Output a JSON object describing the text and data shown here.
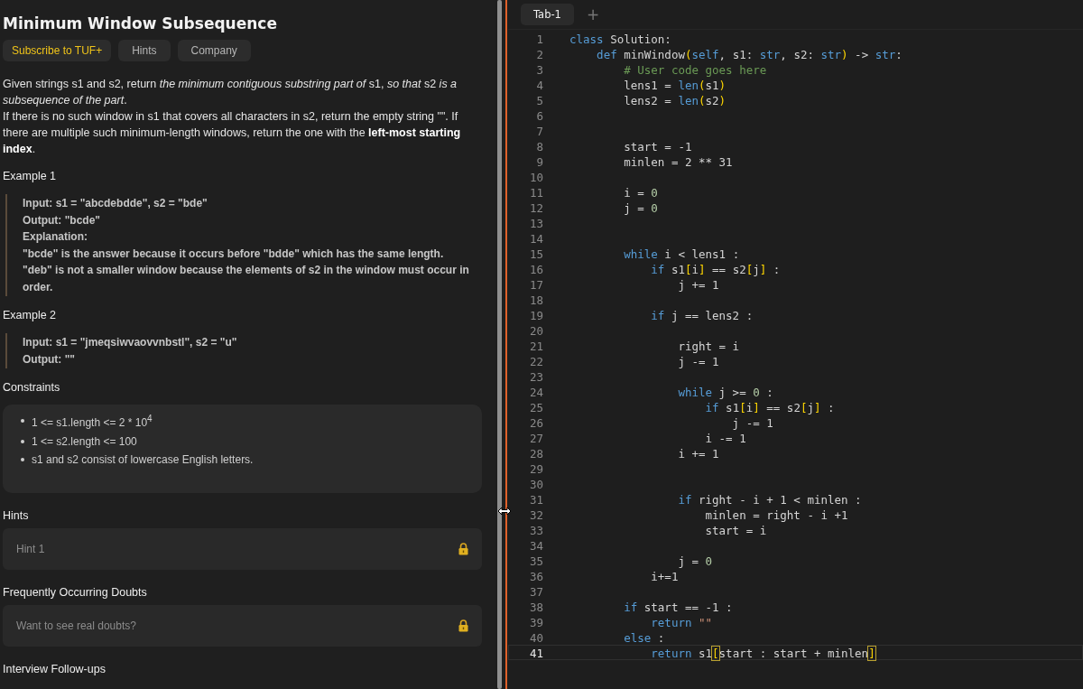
{
  "problem": {
    "title": "Minimum Window Subsequence",
    "buttons": [
      {
        "label": "Subscribe to TUF+",
        "kind": "premium"
      },
      {
        "label": "Hints",
        "kind": "plain"
      },
      {
        "label": "Company",
        "kind": "plain"
      }
    ],
    "description": [
      "Given strings s1 and s2, return *the minimum contiguous substring part of* s1, *so that* s2 *is a subsequence of the part*.",
      "If there is no such window in s1 that covers all characters in s2, return the empty string \"\". If there are multiple such minimum-length windows, return the one with the **left-most starting index**."
    ],
    "examples": [
      {
        "title": "Example 1",
        "lines": [
          "Input: s1 = \"abcdebdde\", s2 = \"bde\"",
          "Output: \"bcde\"",
          "Explanation:",
          "\"bcde\" is the answer because it occurs before \"bdde\" which has the same length.",
          "\"deb\" is not a smaller window because the elements of s2 in the window must occur in order."
        ]
      },
      {
        "title": "Example 2",
        "lines": [
          "Input: s1 = \"jmeqsiwvaovvnbstl\", s2 = \"u\"",
          "Output: \"\""
        ]
      }
    ],
    "constraints_title": "Constraints",
    "constraints": [
      "1 <= s1.length <= 2 * 10$^{4}$",
      "1 <= s2.length <= 100",
      "s1 and s2 consist of lowercase English letters."
    ],
    "sections": [
      {
        "title": "Hints",
        "item": "Hint 1",
        "locked": true
      },
      {
        "title": "Frequently Occurring Doubts",
        "item": "Want to see real doubts?",
        "locked": true
      }
    ],
    "footer_title": "Interview Follow-ups"
  },
  "editor": {
    "tabs": [
      {
        "label": "Tab-1",
        "selected": true
      }
    ],
    "add_tab": "+",
    "lines": [
      {
        "number": "1",
        "active": false,
        "tokens": [
          {
            "kind": "kw",
            "text": "class"
          },
          {
            "kind": "pl",
            "text": " Solution:"
          }
        ]
      },
      {
        "number": "2",
        "active": false,
        "tokens": [
          {
            "kind": "kw",
            "text": "    def"
          },
          {
            "kind": "pl",
            "text": " minWindow"
          },
          {
            "kind": "br",
            "text": "("
          },
          {
            "kind": "kw",
            "text": "self"
          },
          {
            "kind": "pl",
            "text": ", s1: "
          },
          {
            "kind": "kw",
            "text": "str"
          },
          {
            "kind": "pl",
            "text": ", s2: "
          },
          {
            "kind": "kw",
            "text": "str"
          },
          {
            "kind": "br",
            "text": ")"
          },
          {
            "kind": "pl",
            "text": " -> "
          },
          {
            "kind": "kw",
            "text": "str"
          },
          {
            "kind": "pl",
            "text": ":"
          }
        ]
      },
      {
        "number": "3",
        "active": false,
        "tokens": [
          {
            "kind": "cm",
            "text": "        # User code goes here"
          }
        ]
      },
      {
        "number": "4",
        "active": false,
        "tokens": [
          {
            "kind": "pl",
            "text": "        lens1 = "
          },
          {
            "kind": "kw",
            "text": "len"
          },
          {
            "kind": "br",
            "text": "("
          },
          {
            "kind": "pl",
            "text": "s1"
          },
          {
            "kind": "br",
            "text": ")"
          }
        ]
      },
      {
        "number": "5",
        "active": false,
        "tokens": [
          {
            "kind": "pl",
            "text": "        lens2 = "
          },
          {
            "kind": "kw",
            "text": "len"
          },
          {
            "kind": "br",
            "text": "("
          },
          {
            "kind": "pl",
            "text": "s2"
          },
          {
            "kind": "br",
            "text": ")"
          }
        ]
      },
      {
        "number": "6",
        "active": false
      },
      {
        "number": "7",
        "active": false
      },
      {
        "number": "8",
        "active": false,
        "tokens": [
          {
            "kind": "pl",
            "text": "        start = -1"
          }
        ]
      },
      {
        "number": "9",
        "active": false,
        "tokens": [
          {
            "kind": "pl",
            "text": "        minlen = 2 ** 31"
          }
        ]
      },
      {
        "number": "10",
        "active": false
      },
      {
        "number": "11",
        "active": false,
        "tokens": [
          {
            "kind": "pl",
            "text": "        i = "
          },
          {
            "kind": "num",
            "text": "0"
          }
        ]
      },
      {
        "number": "12",
        "active": false,
        "tokens": [
          {
            "kind": "pl",
            "text": "        j = "
          },
          {
            "kind": "num",
            "text": "0"
          }
        ]
      },
      {
        "number": "13",
        "active": false
      },
      {
        "number": "14",
        "active": false
      },
      {
        "number": "15",
        "active": false,
        "tokens": [
          {
            "kind": "kw",
            "text": "        while"
          },
          {
            "kind": "pl",
            "text": " i < lens1 :"
          }
        ]
      },
      {
        "number": "16",
        "active": false,
        "tokens": [
          {
            "kind": "kw",
            "text": "            if"
          },
          {
            "kind": "pl",
            "text": " s1"
          },
          {
            "kind": "br",
            "text": "["
          },
          {
            "kind": "pl",
            "text": "i"
          },
          {
            "kind": "br",
            "text": "]"
          },
          {
            "kind": "pl",
            "text": " == s2"
          },
          {
            "kind": "br",
            "text": "["
          },
          {
            "kind": "pl",
            "text": "j"
          },
          {
            "kind": "br",
            "text": "]"
          },
          {
            "kind": "pl",
            "text": " :"
          }
        ]
      },
      {
        "number": "17",
        "active": false,
        "tokens": [
          {
            "kind": "pl",
            "text": "                j += 1"
          }
        ]
      },
      {
        "number": "18",
        "active": false
      },
      {
        "number": "19",
        "active": false,
        "tokens": [
          {
            "kind": "kw",
            "text": "            if"
          },
          {
            "kind": "pl",
            "text": " j == lens2 :"
          }
        ]
      },
      {
        "number": "20",
        "active": false
      },
      {
        "number": "21",
        "active": false,
        "tokens": [
          {
            "kind": "pl",
            "text": "                right = i"
          }
        ]
      },
      {
        "number": "22",
        "active": false,
        "tokens": [
          {
            "kind": "pl",
            "text": "                j -= 1"
          }
        ]
      },
      {
        "number": "23",
        "active": false
      },
      {
        "number": "24",
        "active": false,
        "tokens": [
          {
            "kind": "kw",
            "text": "                while"
          },
          {
            "kind": "pl",
            "text": " j >= "
          },
          {
            "kind": "num",
            "text": "0"
          },
          {
            "kind": "pl",
            "text": " :"
          }
        ]
      },
      {
        "number": "25",
        "active": false,
        "tokens": [
          {
            "kind": "kw",
            "text": "                    if"
          },
          {
            "kind": "pl",
            "text": " s1"
          },
          {
            "kind": "br",
            "text": "["
          },
          {
            "kind": "pl",
            "text": "i"
          },
          {
            "kind": "br",
            "text": "]"
          },
          {
            "kind": "pl",
            "text": " == s2"
          },
          {
            "kind": "br",
            "text": "["
          },
          {
            "kind": "pl",
            "text": "j"
          },
          {
            "kind": "br",
            "text": "]"
          },
          {
            "kind": "pl",
            "text": " :"
          }
        ]
      },
      {
        "number": "26",
        "active": false,
        "tokens": [
          {
            "kind": "pl",
            "text": "                        j -= 1"
          }
        ]
      },
      {
        "number": "27",
        "active": false,
        "tokens": [
          {
            "kind": "pl",
            "text": "                    i -= 1"
          }
        ]
      },
      {
        "number": "28",
        "active": false,
        "tokens": [
          {
            "kind": "pl",
            "text": "                i += 1"
          }
        ]
      },
      {
        "number": "29",
        "active": false
      },
      {
        "number": "30",
        "active": false
      },
      {
        "number": "31",
        "active": false,
        "tokens": [
          {
            "kind": "kw",
            "text": "                if"
          },
          {
            "kind": "pl",
            "text": " right - i + 1 < minlen :"
          }
        ]
      },
      {
        "number": "32",
        "active": false,
        "tokens": [
          {
            "kind": "pl",
            "text": "                    minlen = right - i +1"
          }
        ]
      },
      {
        "number": "33",
        "active": false,
        "tokens": [
          {
            "kind": "pl",
            "text": "                    start = i"
          }
        ]
      },
      {
        "number": "34",
        "active": false
      },
      {
        "number": "35",
        "active": false,
        "tokens": [
          {
            "kind": "pl",
            "text": "                j = "
          },
          {
            "kind": "num",
            "text": "0"
          }
        ]
      },
      {
        "number": "36",
        "active": false,
        "tokens": [
          {
            "kind": "pl",
            "text": "            i+=1"
          }
        ]
      },
      {
        "number": "37",
        "active": false
      },
      {
        "number": "38",
        "active": false,
        "tokens": [
          {
            "kind": "kw",
            "text": "        if"
          },
          {
            "kind": "pl",
            "text": " start == -1 :"
          }
        ]
      },
      {
        "number": "39",
        "active": false,
        "tokens": [
          {
            "kind": "kw",
            "text": "            return"
          },
          {
            "kind": "str",
            "text": " \"\""
          }
        ]
      },
      {
        "number": "40",
        "active": false,
        "tokens": [
          {
            "kind": "kw",
            "text": "        else"
          },
          {
            "kind": "pl",
            "text": " :"
          }
        ]
      },
      {
        "number": "41",
        "active": true,
        "tokens": [
          {
            "kind": "kw",
            "text": "            return"
          },
          {
            "kind": "pl",
            "text": " s1"
          },
          {
            "kind": "match",
            "text": "["
          },
          {
            "kind": "pl",
            "text": "start : start + minlen"
          },
          {
            "kind": "match",
            "text": "]"
          }
        ]
      }
    ]
  }
}
